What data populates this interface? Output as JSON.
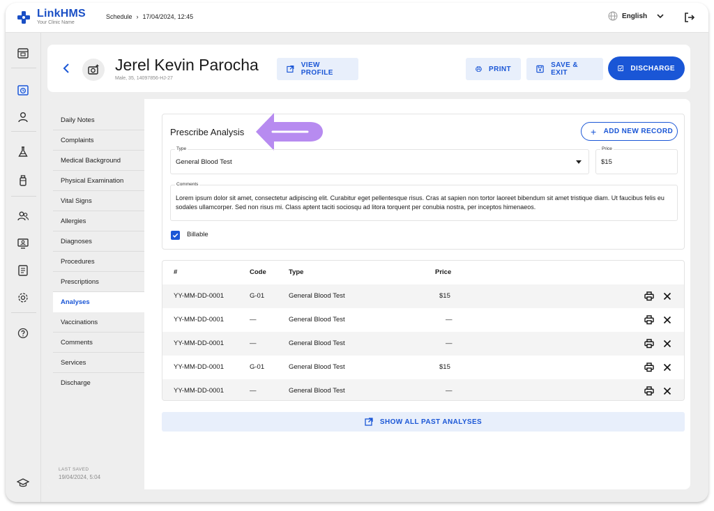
{
  "app": {
    "name": "LinkHMS",
    "subtitle": "Your Clinic Name"
  },
  "breadcrumb": {
    "section": "Schedule",
    "separator": "›",
    "datetime": "17/04/2024, 12:45"
  },
  "language": "English",
  "rail_icons": [
    "calendar-day-icon",
    "calendar-clock-icon",
    "user-icon",
    "flask-icon",
    "bottle-icon",
    "users-icon",
    "monitor-user-icon",
    "document-list-icon",
    "gear-icon",
    "help-icon",
    "graduation-cap-icon"
  ],
  "patient": {
    "name": "Jerel Kevin Parocha",
    "meta": "Male, 35, 14097856-HJ-27"
  },
  "header_buttons": {
    "view_profile": "VIEW PROFILE",
    "print": "PRINT",
    "save_exit": "SAVE & EXIT",
    "discharge": "DISCHARGE"
  },
  "subnav": {
    "items": [
      "Daily Notes",
      "Complaints",
      "Medical Background",
      "Physical Examination",
      "Vital Signs",
      "Allergies",
      "Diagnoses",
      "Procedures",
      "Prescriptions",
      "Analyses",
      "Vaccinations",
      "Comments",
      "Services",
      "Discharge"
    ],
    "active": "Analyses",
    "last_saved_label": "LAST SAVED",
    "last_saved_value": "19/04/2024, 5:04"
  },
  "form": {
    "title": "Prescribe Analysis",
    "add_button": "ADD NEW RECORD",
    "type_label": "Type",
    "type_value": "General Blood Test",
    "price_label": "Price",
    "price_value": "$15",
    "comments_label": "Comments",
    "comments_value": "Lorem ipsum dolor sit amet, consectetur adipiscing elit. Curabitur eget pellentesque risus. Cras at sapien non tortor laoreet bibendum sit amet tristique diam. Ut faucibus felis eu sodales ullamcorper. Sed non risus mi. Class aptent taciti sociosqu ad litora torquent per conubia nostra, per inceptos himenaeos.",
    "billable_label": "Billable",
    "billable_checked": true
  },
  "table": {
    "headers": {
      "num": "#",
      "code": "Code",
      "type": "Type",
      "price": "Price"
    },
    "rows": [
      {
        "num": "YY-MM-DD-0001",
        "code": "G-01",
        "type": "General Blood Test",
        "price": "$15"
      },
      {
        "num": "YY-MM-DD-0001",
        "code": "—",
        "type": "General Blood Test",
        "price": "—"
      },
      {
        "num": "YY-MM-DD-0001",
        "code": "—",
        "type": "General Blood Test",
        "price": "—"
      },
      {
        "num": "YY-MM-DD-0001",
        "code": "G-01",
        "type": "General Blood Test",
        "price": "$15"
      },
      {
        "num": "YY-MM-DD-0001",
        "code": "—",
        "type": "General Blood Test",
        "price": "—"
      }
    ]
  },
  "show_all_button": "SHOW ALL PAST ANALYSES",
  "colors": {
    "primary": "#1a56d6",
    "primary_light": "#e8effb",
    "annotation_arrow": "#b78bf0"
  }
}
